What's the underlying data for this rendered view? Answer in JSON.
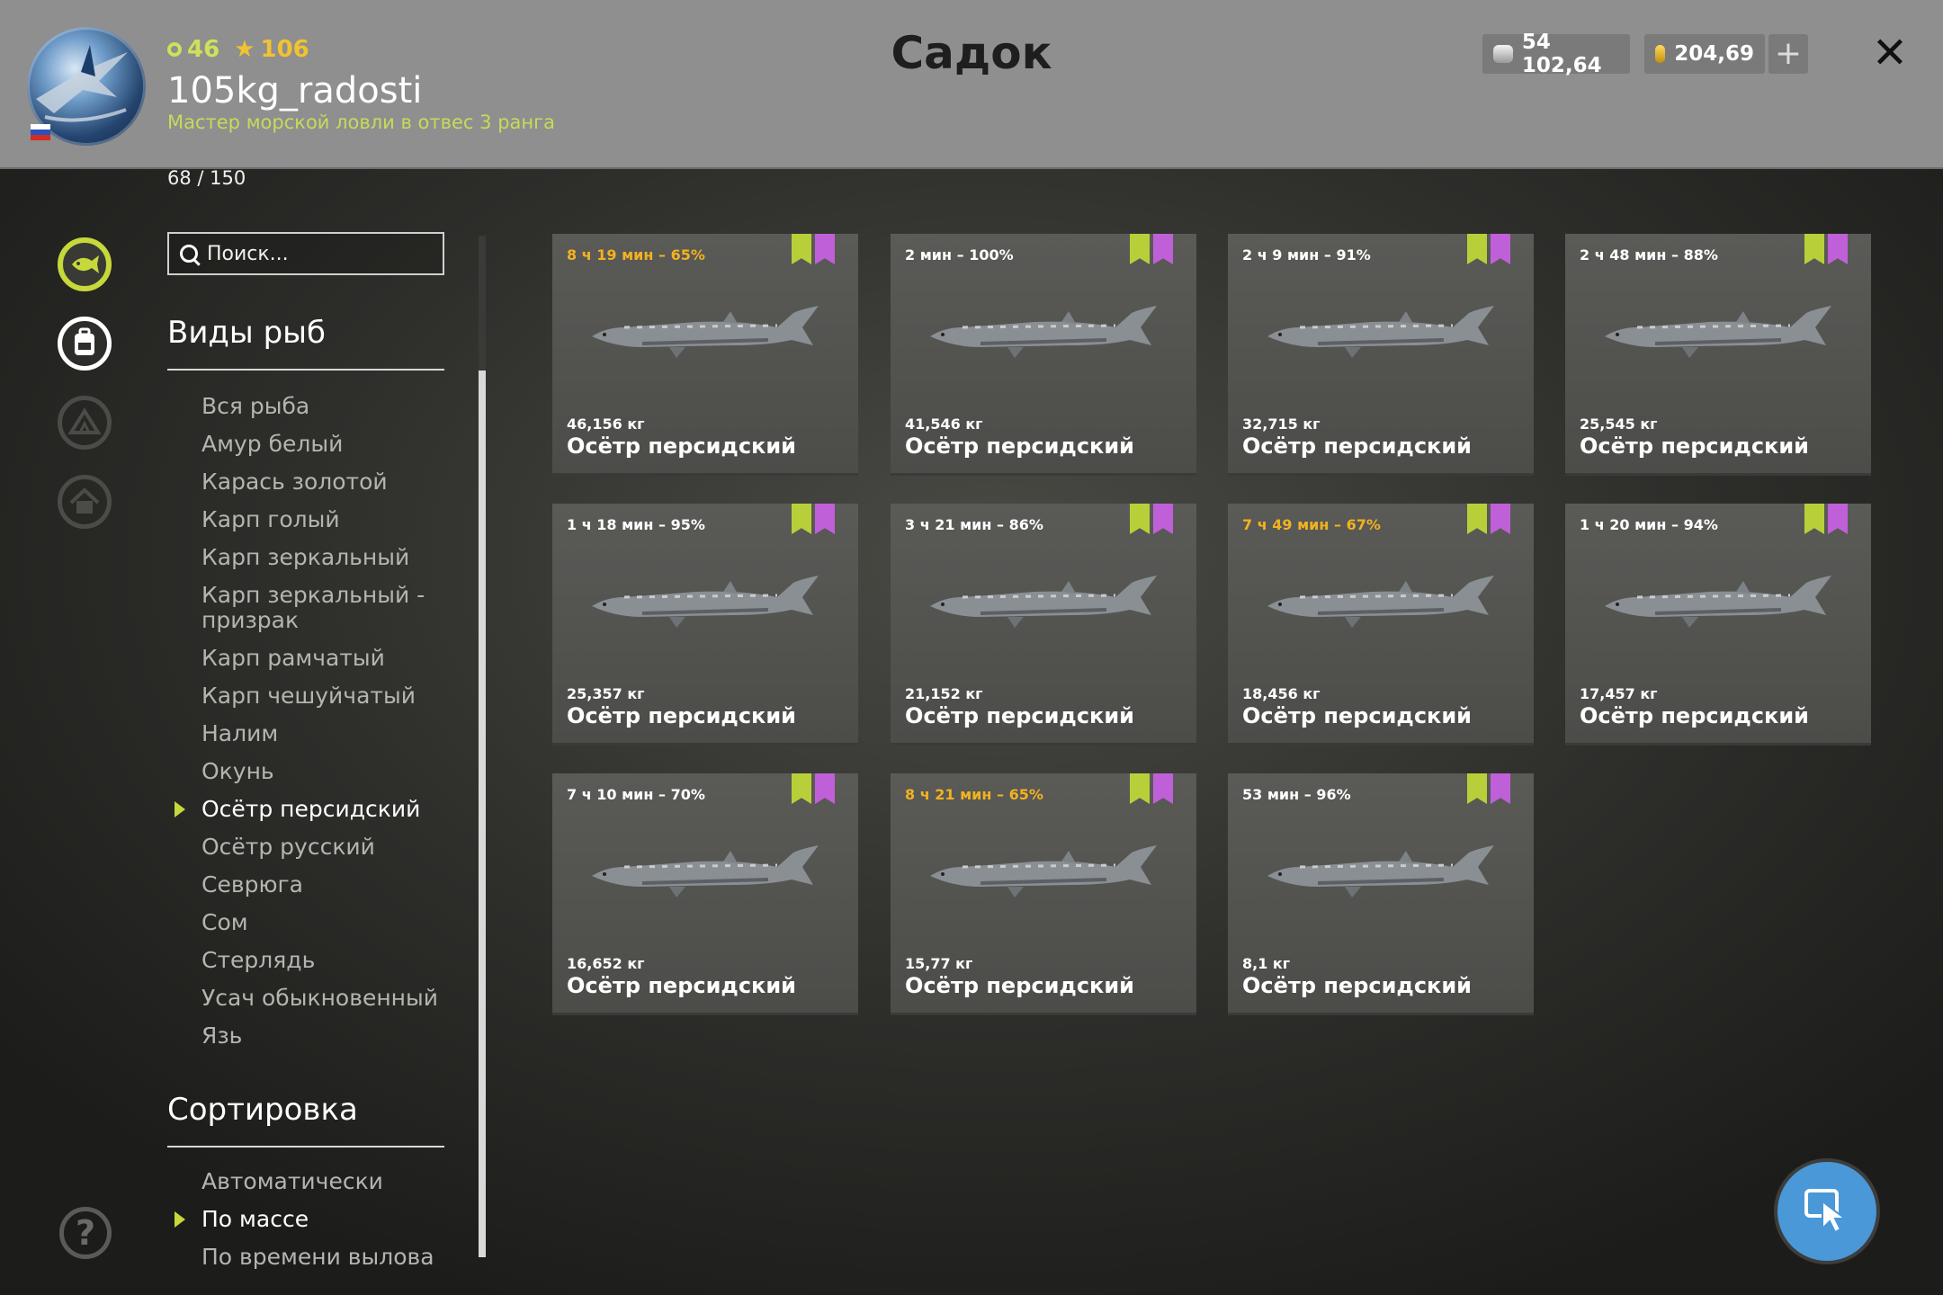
{
  "header": {
    "title": "Садок",
    "level": "46",
    "stars": "106",
    "username": "105kg_radosti",
    "rank": "Мастер морской ловли в отвес 3 ранга",
    "silver": "54 102,64",
    "gold": "204,69",
    "plus": "+",
    "close": "✕"
  },
  "capacity": "68 / 150",
  "search": {
    "placeholder": "Поиск..."
  },
  "species": {
    "title": "Виды рыб",
    "items": [
      {
        "label": "Вся рыба"
      },
      {
        "label": "Амур белый"
      },
      {
        "label": "Карась золотой"
      },
      {
        "label": "Карп голый"
      },
      {
        "label": "Карп зеркальный"
      },
      {
        "label": "Карп зеркальный - призрак"
      },
      {
        "label": "Карп рамчатый"
      },
      {
        "label": "Карп чешуйчатый"
      },
      {
        "label": "Налим"
      },
      {
        "label": "Окунь"
      },
      {
        "label": "Осётр персидский",
        "active": true
      },
      {
        "label": "Осётр русский"
      },
      {
        "label": "Севрюга"
      },
      {
        "label": "Сом"
      },
      {
        "label": "Стерлядь"
      },
      {
        "label": "Усач обыкновенный"
      },
      {
        "label": "Язь"
      }
    ]
  },
  "sort": {
    "title": "Сортировка",
    "items": [
      {
        "label": "Автоматически"
      },
      {
        "label": "По массе",
        "active": true
      },
      {
        "label": "По времени вылова"
      }
    ]
  },
  "colors": {
    "accent": "#c6d83a",
    "warn": "#f2b220",
    "star_badge": "#c060d8",
    "fab": "#4a98d8"
  },
  "cards": [
    {
      "time": "8 ч 19 мин – 65%",
      "warn": true,
      "weight": "46,156 кг",
      "name": "Осётр персидский"
    },
    {
      "time": "2 мин – 100%",
      "warn": false,
      "weight": "41,546 кг",
      "name": "Осётр персидский"
    },
    {
      "time": "2 ч 9 мин – 91%",
      "warn": false,
      "weight": "32,715 кг",
      "name": "Осётр персидский"
    },
    {
      "time": "2 ч 48 мин – 88%",
      "warn": false,
      "weight": "25,545 кг",
      "name": "Осётр персидский"
    },
    {
      "time": "1 ч 18 мин – 95%",
      "warn": false,
      "weight": "25,357 кг",
      "name": "Осётр персидский"
    },
    {
      "time": "3 ч 21 мин – 86%",
      "warn": false,
      "weight": "21,152 кг",
      "name": "Осётр персидский"
    },
    {
      "time": "7 ч 49 мин – 67%",
      "warn": true,
      "weight": "18,456 кг",
      "name": "Осётр персидский"
    },
    {
      "time": "1 ч 20 мин – 94%",
      "warn": false,
      "weight": "17,457 кг",
      "name": "Осётр персидский"
    },
    {
      "time": "7 ч 10 мин – 70%",
      "warn": false,
      "weight": "16,652 кг",
      "name": "Осётр персидский"
    },
    {
      "time": "8 ч 21 мин – 65%",
      "warn": true,
      "weight": "15,77 кг",
      "name": "Осётр персидский"
    },
    {
      "time": "53 мин – 96%",
      "warn": false,
      "weight": "8,1 кг",
      "name": "Осётр персидский"
    }
  ]
}
